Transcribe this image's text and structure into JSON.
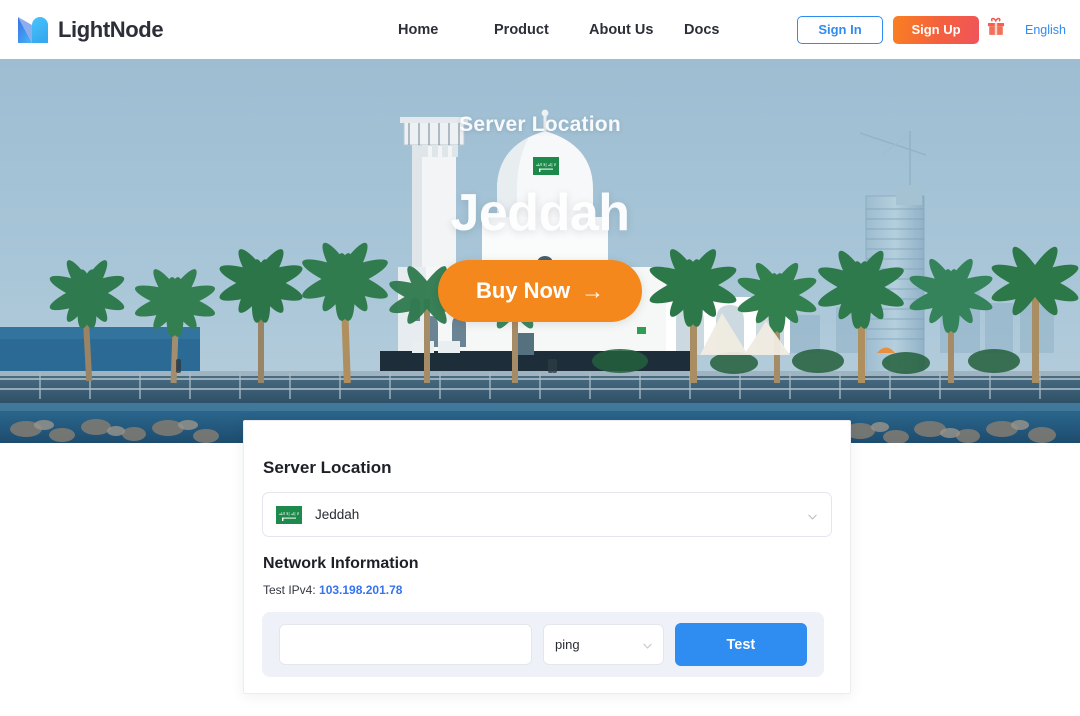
{
  "header": {
    "logo": {
      "icon": "lightnode-logo-icon",
      "text": "LightNode"
    },
    "nav": [
      {
        "label": "Home"
      },
      {
        "label": "Product"
      },
      {
        "label": "About Us"
      },
      {
        "label": "Docs"
      }
    ],
    "sign_in_label": "Sign In",
    "sign_up_label": "Sign Up",
    "gift_icon": "gift-icon",
    "language_label": "English",
    "colors": {
      "accent_blue": "#2f8cf0",
      "signup_gradient_start": "#f98021",
      "signup_gradient_end": "#f0545a"
    }
  },
  "hero": {
    "subtitle": "Server Location",
    "title": "Jeddah",
    "flag_icon": "saudi-arabia-flag-icon",
    "cta_label": "Buy Now",
    "cta_arrow": "→",
    "cta_color": "#f5881c"
  },
  "card": {
    "server_location_heading": "Server Location",
    "location_select": {
      "value": "Jeddah",
      "flag_icon": "saudi-arabia-flag-icon",
      "chevron_icon": "chevron-down-icon"
    },
    "network_heading": "Network Information",
    "ip_label": "Test IPv4:",
    "ip_value": "103.198.201.78",
    "test_panel": {
      "input_value": "",
      "input_placeholder": "",
      "method_value": "ping",
      "method_chevron_icon": "chevron-down-icon",
      "test_button_label": "Test",
      "test_button_color": "#2f8cf0"
    }
  }
}
